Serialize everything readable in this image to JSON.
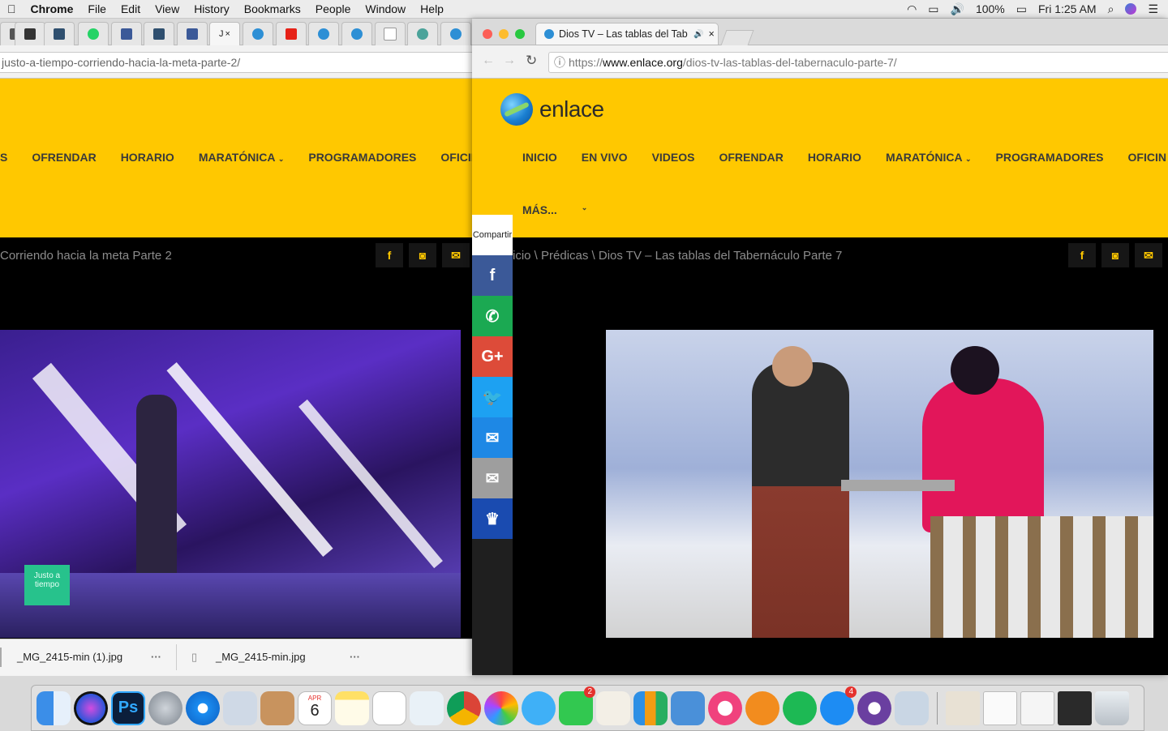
{
  "menubar": {
    "app": "Chrome",
    "items": [
      "File",
      "Edit",
      "View",
      "History",
      "Bookmarks",
      "People",
      "Window",
      "Help"
    ],
    "battery": "100%",
    "clock": "Fri 1:25 AM"
  },
  "left_window": {
    "url": "justo-a-tiempo-corriendo-hacia-la-meta-parte-2/",
    "tab_active_letter": "J",
    "nav": [
      "S",
      "OFRENDAR",
      "HORARIO",
      "MARATÓNICA",
      "PROGRAMADORES",
      "OFICIN"
    ],
    "breadcrumb": "Corriendo hacia la meta Parte 2",
    "downloads": [
      "_MG_2415-min (1).jpg",
      "_MG_2415-min.jpg"
    ],
    "video_caption": "Justo a tiempo"
  },
  "right_window": {
    "tab_title": "Dios TV – Las tablas del Tab",
    "url_prefix": "https://",
    "url_host": "www.enlace.org",
    "url_path": "/dios-tv-las-tablas-del-tabernaculo-parte-7/",
    "logo_text": "enlace",
    "nav": [
      "INICIO",
      "EN VIVO",
      "VIDEOS",
      "OFRENDAR",
      "HORARIO",
      "MARATÓNICA",
      "PROGRAMADORES",
      "OFICIN"
    ],
    "nav_more": "MÁS...",
    "breadcrumb": "icio \\ Prédicas \\ Dios TV – Las tablas del Tabernáculo Parte 7"
  },
  "share": {
    "label": "Compartir",
    "buttons": [
      {
        "name": "facebook",
        "glyph": "f",
        "color": "#3b5998"
      },
      {
        "name": "whatsapp",
        "glyph": "✆",
        "color": "#1ba952"
      },
      {
        "name": "google-plus",
        "glyph": "G+",
        "color": "#dd4b39"
      },
      {
        "name": "twitter",
        "glyph": "🐦",
        "color": "#1da1f2"
      },
      {
        "name": "sms",
        "glyph": "✉",
        "color": "#1e88e5"
      },
      {
        "name": "email",
        "glyph": "✉",
        "color": "#9e9e9e"
      },
      {
        "name": "sumo",
        "glyph": "♛",
        "color": "#1a4bb0"
      }
    ]
  },
  "dock": {
    "calendar_month": "APR",
    "calendar_day": "6",
    "facetime_badge": "2",
    "appstore_badge": "4"
  }
}
